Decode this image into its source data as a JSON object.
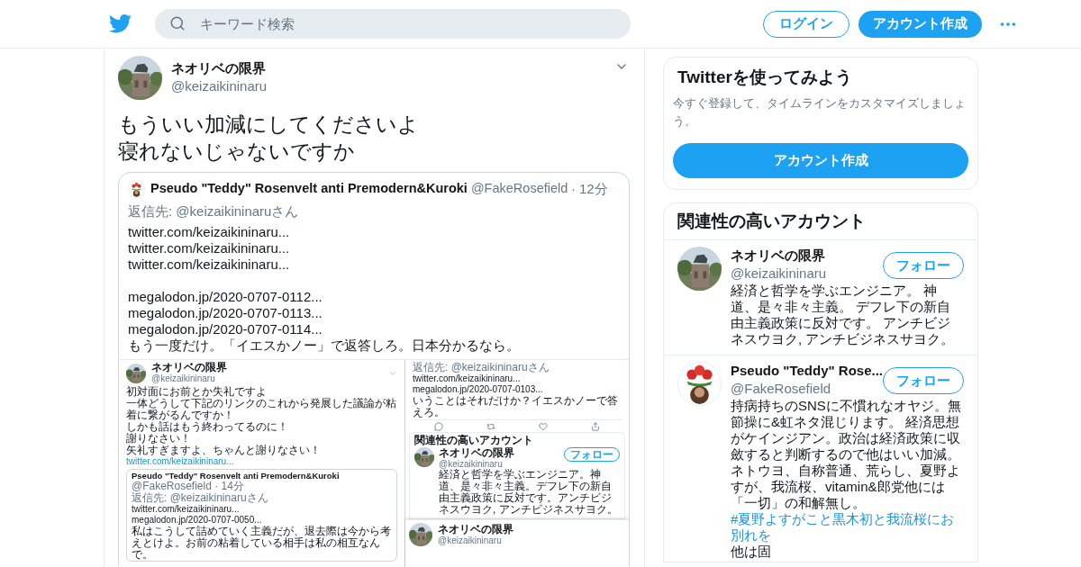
{
  "header": {
    "search": {
      "placeholder": "キーワード検索"
    },
    "login": "ログイン",
    "signup": "アカウント作成"
  },
  "tweet": {
    "name": "ネオリベの限界",
    "handle": "@keizaikininaru",
    "lines": [
      "もういい加減にしてくださいよ",
      "寝れないじゃないですか"
    ],
    "quote": {
      "name": "Pseudo \"Teddy\" Rosenvelt anti Premodern&Kuroki",
      "handle": "@FakeRosefield",
      "separator": "·",
      "time": "12分",
      "reply_to": "返信先: @keizaikininaruさん",
      "paragraphs": [
        [
          "twitter.com/keizaikininaru...",
          "twitter.com/keizaikininaru...",
          "twitter.com/keizaikininaru..."
        ],
        [
          "megalodon.jp/2020-0707-0112...",
          "megalodon.jp/2020-0707-0113...",
          "megalodon.jp/2020-0707-0114...",
          "もう一度だけ。「イエスかノー」で返答しろ。日本分かるなら。"
        ]
      ],
      "attachment": {
        "left": {
          "name": "ネオリベの限界",
          "handle": "@keizaikininaru",
          "lines": [
            "初対面にお前とか失礼ですよ",
            "一体どうして下記のリンクのこれから発展した議論が粘着に繋がるんですか！",
            "しかも話はもう終わってるのに！",
            "謝りなさい！",
            "矢礼すぎますよ、ちゃんと謝りなさい！"
          ],
          "link": "twitter.com/keizaikininaru...",
          "quote": {
            "name": "Pseudo \"Teddy\" Rosenvelt anti Premodern&Kuroki",
            "meta": "@FakeRosefield · 14分",
            "reply_to": "返信先: @keizaikininaruさん",
            "lines": [
              "twitter.com/keizaikininaru...",
              "megalodon.jp/2020-0707-0050...",
              "私はこうして詰めていく主義だが、退去際は今から考えとけよ。お前の粘着している相手は私の相互なんで。"
            ]
          }
        },
        "right": {
          "reply_to": "返信先: @keizaikininaruさん",
          "lines": [
            "twitter.com/keizaikininaru...",
            "megalodon.jp/2020-0707-0103...",
            "いうことはそれだけか？イエスかノーで答えろ。"
          ],
          "related": {
            "title": "関連性の高いアカウント",
            "name": "ネオリベの限界",
            "handle": "@keizaikininaru",
            "follow": "フォロー",
            "bio": "経済と哲学を学ぶエンジニア。神道、是々非々主義。デフレ下の新自由主義政策に反対です。アンチビジネスウヨク, アンチビジネスサヨク。"
          },
          "bottom_tweet": {
            "name": "ネオリベの限界",
            "handle": "@keizaikininaru"
          }
        }
      }
    }
  },
  "sidebar": {
    "signup_card": {
      "title": "Twitterを使ってみよう",
      "text": "今すぐ登録して、タイムラインをカスタマイズしましょう。",
      "button": "アカウント作成"
    },
    "related": {
      "title": "関連性の高いアカウント",
      "accounts": [
        {
          "name": "ネオリベの限界",
          "handle": "@keizaikininaru",
          "follow": "フォロー",
          "bio": [
            {
              "kind": "text",
              "text": "経済と哲学を学ぶエンジニア。 神道、是々非々主義。 デフレ下の新自由主義政策に反対です。 アンチビジネスウヨク, アンチビジネスサヨク。"
            }
          ]
        },
        {
          "name": "Pseudo \"Teddy\" Rose...",
          "handle": "@FakeRosefield",
          "follow": "フォロー",
          "bio": [
            {
              "kind": "text",
              "text": "持病持ちのSNSに不慣れなオヤジ。無節操に&虹ネタ混じります。 経済思想がケインジアン。政治は経済政策に収斂すると判断するので他はいい加減。ネトウヨ、自称普通、荒らし、夏野よすが、我流桜、vitamin&郎党他には「一切」の和解無し。 "
            },
            {
              "kind": "hashtag",
              "text": "#夏野よすがこと黒木初と我流桜にお別れを"
            },
            {
              "kind": "text",
              "text": " 他は固"
            }
          ]
        }
      ]
    }
  }
}
